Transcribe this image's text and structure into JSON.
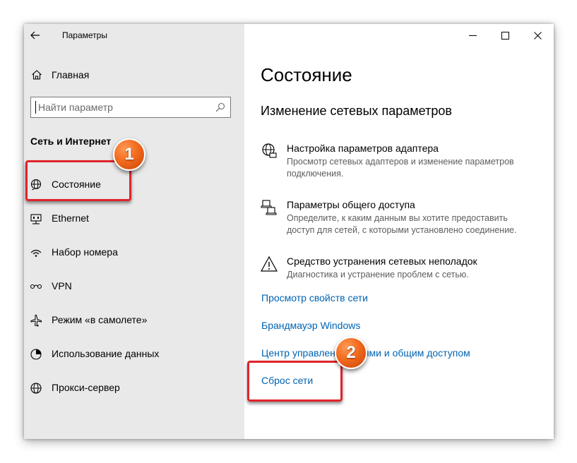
{
  "window": {
    "title": "Параметры"
  },
  "sidebar": {
    "home_label": "Главная",
    "search_placeholder": "Найти параметр",
    "section_title": "Сеть и Интернет",
    "items": [
      {
        "label": "Состояние",
        "icon": "status-globe-icon",
        "selected": true
      },
      {
        "label": "Ethernet",
        "icon": "ethernet-icon"
      },
      {
        "label": "Набор номера",
        "icon": "dialup-icon"
      },
      {
        "label": "VPN",
        "icon": "vpn-icon"
      },
      {
        "label": "Режим «в самолете»",
        "icon": "airplane-icon"
      },
      {
        "label": "Использование данных",
        "icon": "data-usage-icon"
      },
      {
        "label": "Прокси-сервер",
        "icon": "globe-icon"
      }
    ]
  },
  "main": {
    "title": "Состояние",
    "subtitle": "Изменение сетевых параметров",
    "options": [
      {
        "icon": "adapter-globe-icon",
        "title": "Настройка параметров адаптера",
        "desc": "Просмотр сетевых адаптеров и изменение параметров подключения."
      },
      {
        "icon": "sharing-icon",
        "title": "Параметры общего доступа",
        "desc": "Определите, к каким данным вы хотите предоставить доступ для сетей, с которыми установлено соединение."
      },
      {
        "icon": "warning-icon",
        "title": "Средство устранения сетевых неполадок",
        "desc": "Диагностика и устранение проблем с сетью."
      }
    ],
    "links": [
      "Просмотр свойств сети",
      "Брандмауэр Windows",
      "Центр управления сетями и общим доступом",
      "Сброс сети"
    ]
  },
  "annotations": {
    "badge1": "1",
    "badge2": "2",
    "color": "#e0242a"
  },
  "colors": {
    "sidebar_bg": "#e9e9e9",
    "link": "#0063b1",
    "badge": "#f26a1d"
  }
}
